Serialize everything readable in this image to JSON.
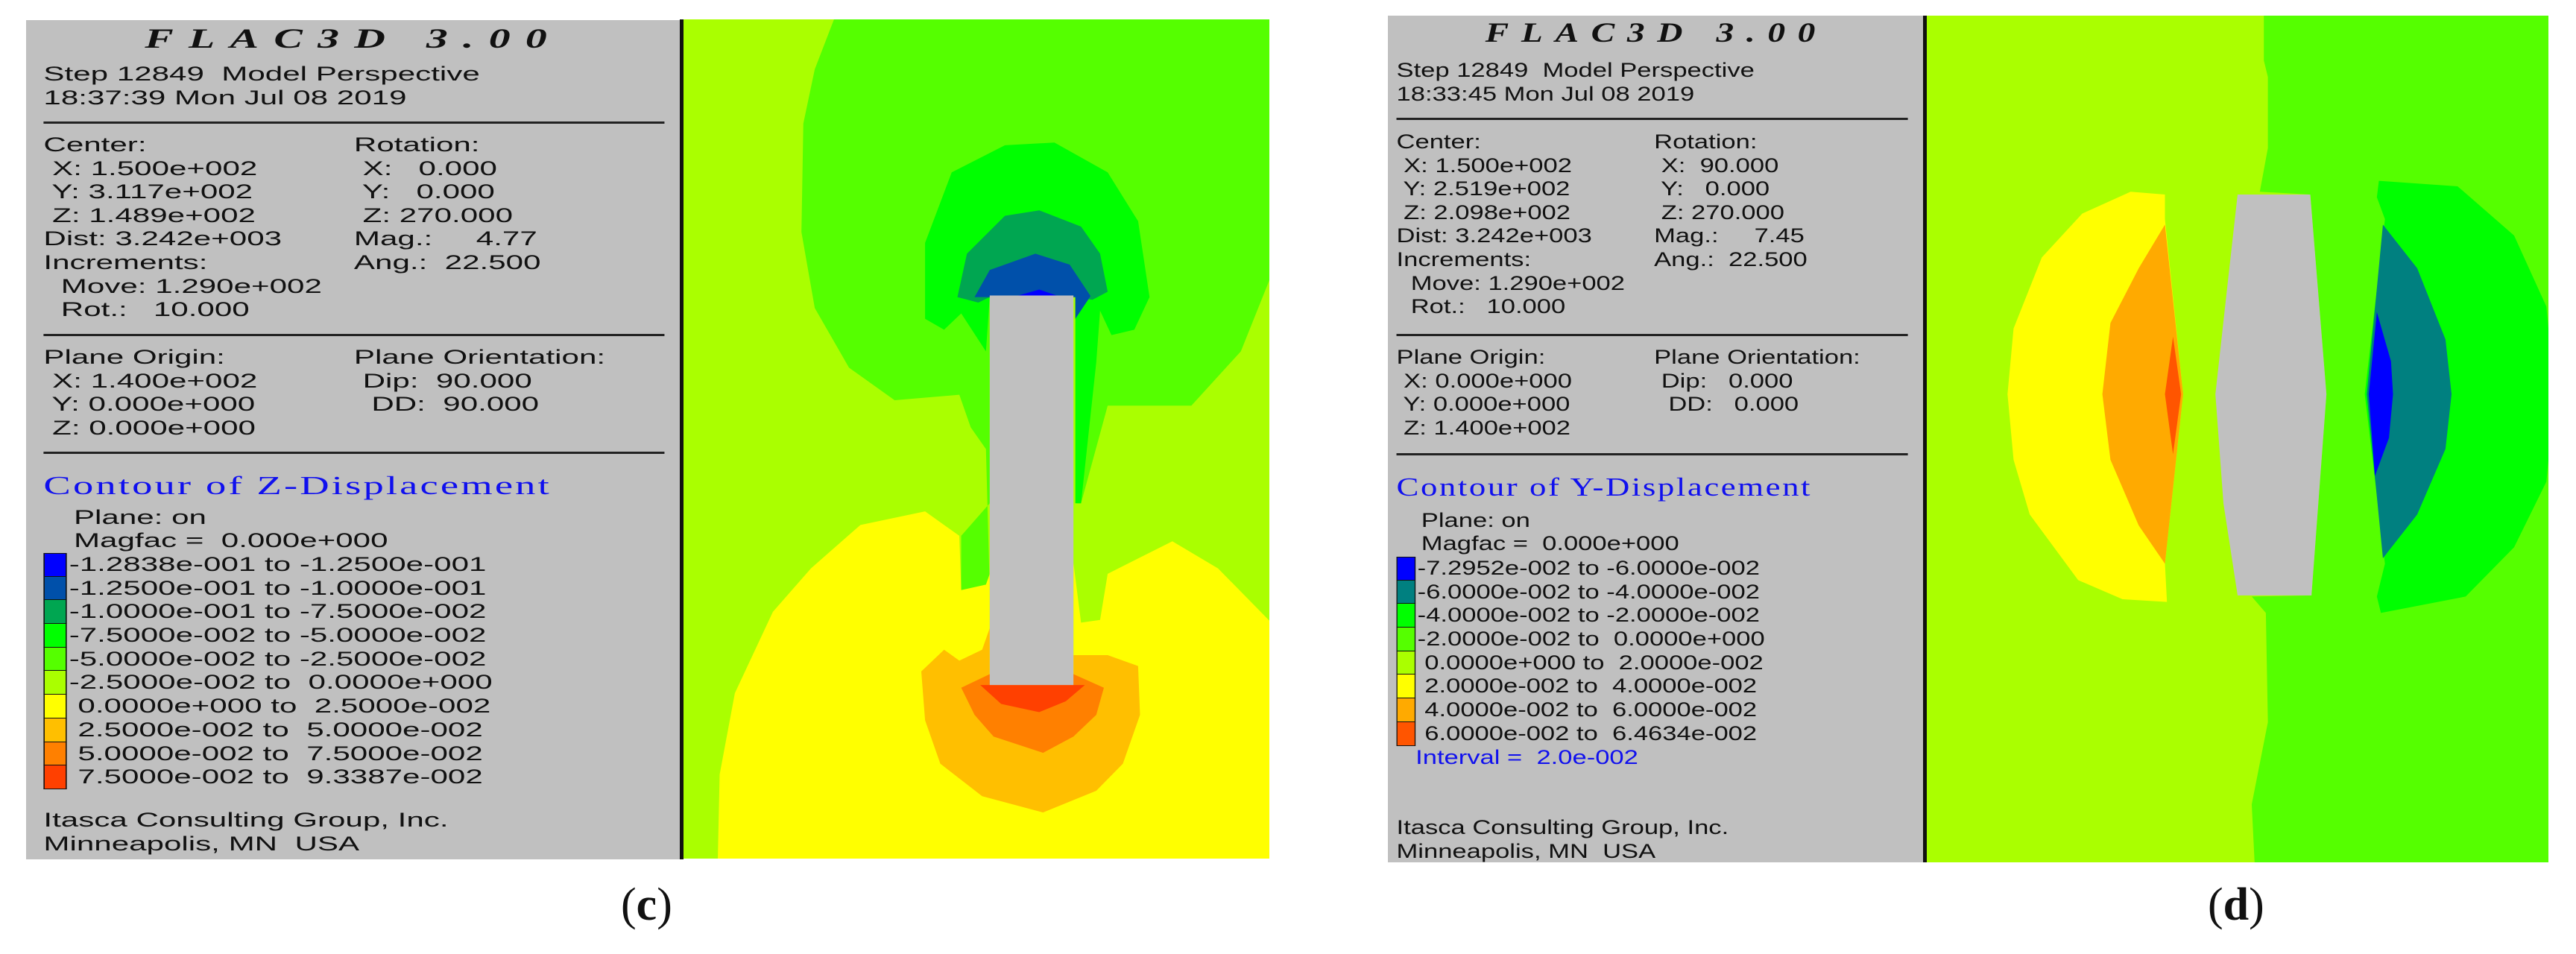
{
  "figures": [
    {
      "id": "c",
      "app_title": "FLAC3D 3.00",
      "step_line": "Step 12849  Model Perspective",
      "time_line": "18:37:39 Mon Jul 08 2019",
      "view_left": [
        "Center:",
        " X: 1.500e+002",
        " Y: 3.117e+002",
        " Z: 1.489e+002",
        "Dist: 3.242e+003",
        "Increments:",
        "  Move: 1.290e+002",
        "  Rot.:   10.000"
      ],
      "view_right": [
        "Rotation:",
        " X:   0.000",
        " Y:   0.000",
        " Z: 270.000",
        "Mag.:     4.77",
        "Ang.:  22.500"
      ],
      "plane_left": [
        "Plane Origin:",
        " X: 1.400e+002",
        " Y: 0.000e+000",
        " Z: 0.000e+000"
      ],
      "plane_right": [
        "Plane Orientation:",
        " Dip:  90.000",
        "  DD:  90.000"
      ],
      "contour_title": "Contour of Z-Displacement",
      "plane_status": "Plane: on",
      "magfac": "Magfac =  0.000e+000",
      "legend": [
        {
          "range": "-1.2838e-001 to -1.2500e-001",
          "color": "#0000ff"
        },
        {
          "range": "-1.2500e-001 to -1.0000e-001",
          "color": "#0050aa"
        },
        {
          "range": "-1.0000e-001 to -7.5000e-002",
          "color": "#00a651"
        },
        {
          "range": "-7.5000e-002 to -5.0000e-002",
          "color": "#00ff00"
        },
        {
          "range": "-5.0000e-002 to -2.5000e-002",
          "color": "#55ff00"
        },
        {
          "range": "-2.5000e-002 to  0.0000e+000",
          "color": "#aaff00"
        },
        {
          "range": " 0.0000e+000 to  2.5000e-002",
          "color": "#ffff00"
        },
        {
          "range": " 2.5000e-002 to  5.0000e-002",
          "color": "#ffbf00"
        },
        {
          "range": " 5.0000e-002 to  7.5000e-002",
          "color": "#ff8000"
        },
        {
          "range": " 7.5000e-002 to  9.3387e-002",
          "color": "#ff4000"
        }
      ],
      "footer": [
        "Itasca Consulting Group, Inc.",
        "Minneapolis, MN  USA"
      ],
      "caption": {
        "open": "(",
        "letter": "c",
        "close": ")"
      }
    },
    {
      "id": "d",
      "app_title": "FLAC3D 3.00",
      "step_line": "Step 12849  Model Perspective",
      "time_line": "18:33:45 Mon Jul 08 2019",
      "view_left": [
        "Center:",
        " X: 1.500e+002",
        " Y: 2.519e+002",
        " Z: 2.098e+002",
        "Dist: 3.242e+003",
        "Increments:",
        "  Move: 1.290e+002",
        "  Rot.:   10.000"
      ],
      "view_right": [
        "Rotation:",
        " X:  90.000",
        " Y:   0.000",
        " Z: 270.000",
        "Mag.:     7.45",
        "Ang.:  22.500"
      ],
      "plane_left": [
        "Plane Origin:",
        " X: 0.000e+000",
        " Y: 0.000e+000",
        " Z: 1.400e+002"
      ],
      "plane_right": [
        "Plane Orientation:",
        " Dip:   0.000",
        "  DD:   0.000"
      ],
      "contour_title": "Contour of Y-Displacement",
      "plane_status": "Plane: on",
      "magfac": "Magfac =  0.000e+000",
      "legend": [
        {
          "range": "-7.2952e-002 to -6.0000e-002",
          "color": "#0000ff"
        },
        {
          "range": "-6.0000e-002 to -4.0000e-002",
          "color": "#008080"
        },
        {
          "range": "-4.0000e-002 to -2.0000e-002",
          "color": "#00ff00"
        },
        {
          "range": "-2.0000e-002 to  0.0000e+000",
          "color": "#55ff00"
        },
        {
          "range": " 0.0000e+000 to  2.0000e-002",
          "color": "#aaff00"
        },
        {
          "range": " 2.0000e-002 to  4.0000e-002",
          "color": "#ffff00"
        },
        {
          "range": " 4.0000e-002 to  6.0000e-002",
          "color": "#ffaa00"
        },
        {
          "range": " 6.0000e-002 to  6.4634e-002",
          "color": "#ff5500"
        }
      ],
      "interval": "Interval =  2.0e-002",
      "footer": [
        "Itasca Consulting Group, Inc.",
        "Minneapolis, MN  USA"
      ],
      "caption": {
        "open": "(",
        "letter": "d",
        "close": ")"
      }
    }
  ],
  "colors": {
    "panel_bg": "#c0c0c0",
    "excavation": "#c0c0c0",
    "title_blue": "#1010ee"
  }
}
